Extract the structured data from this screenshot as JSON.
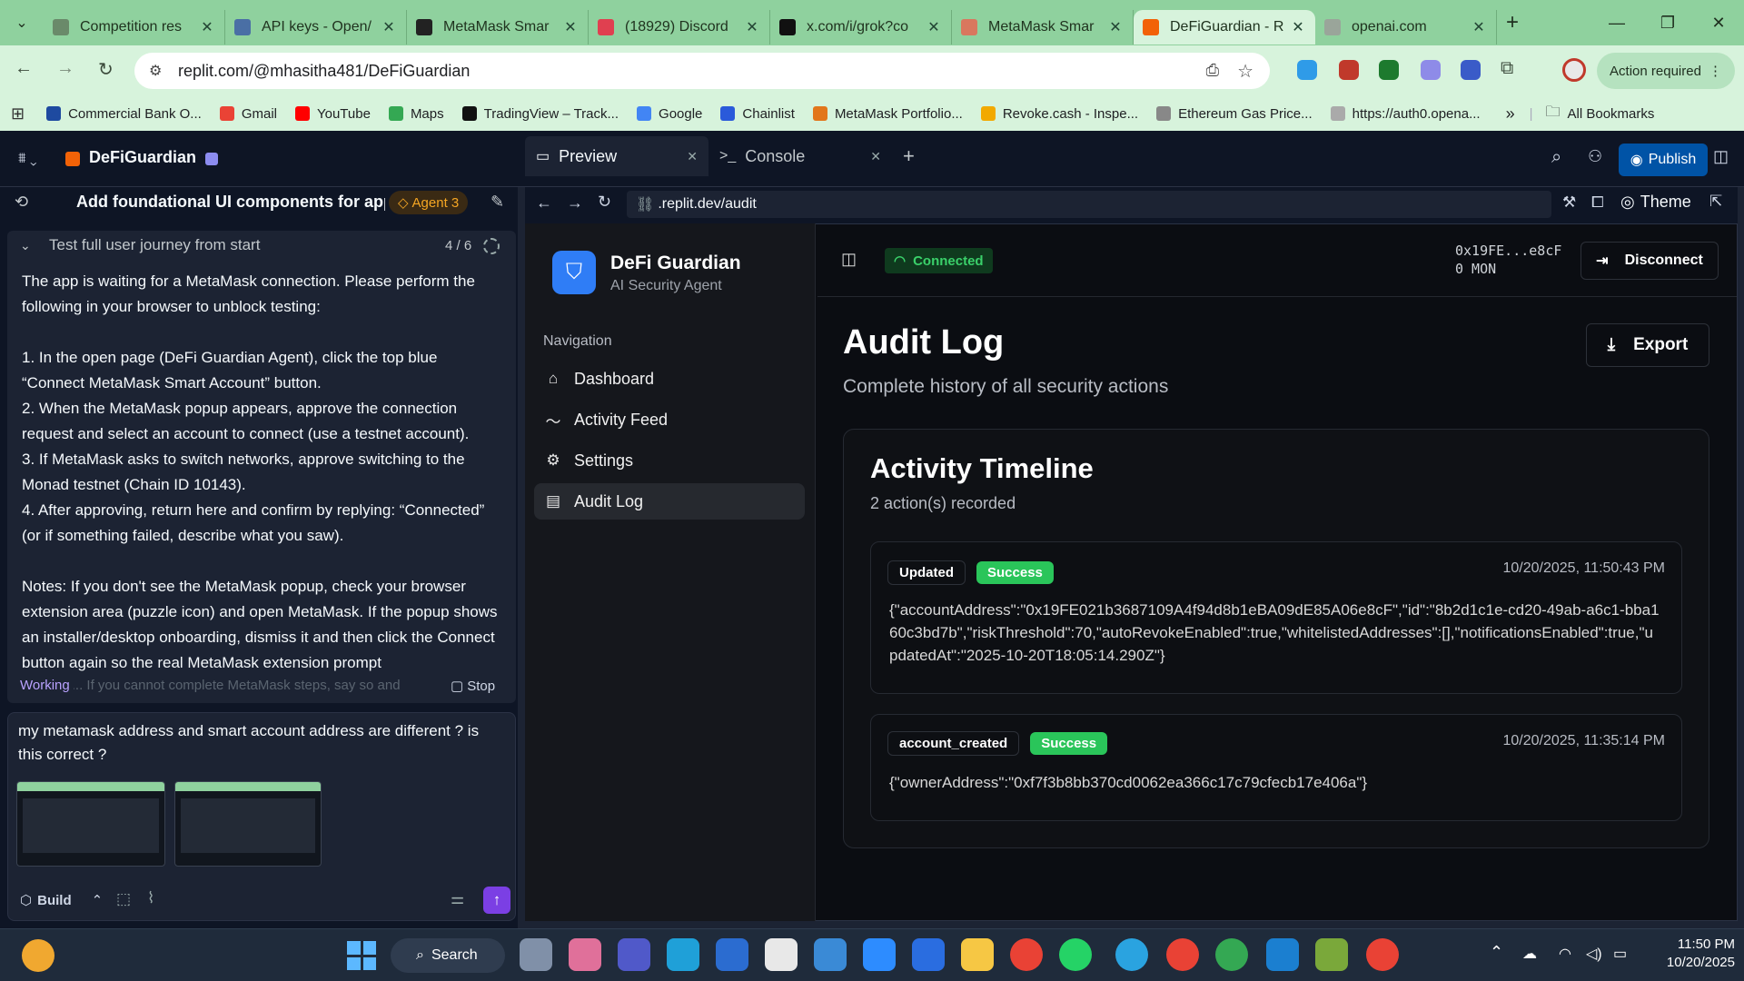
{
  "browser": {
    "tabs": [
      {
        "title": "Competition res",
        "color": "#6a8a6a"
      },
      {
        "title": "API keys - Open/",
        "color": "#4a6fa5"
      },
      {
        "title": "MetaMask Smar",
        "color": "#222222"
      },
      {
        "title": "(18929) Discord",
        "color": "#e04050"
      },
      {
        "title": "x.com/i/grok?co",
        "color": "#111111"
      },
      {
        "title": "MetaMask Smar",
        "color": "#d9775e"
      },
      {
        "title": "DeFiGuardian - R",
        "color": "#f26207"
      },
      {
        "title": "openai.com",
        "color": "#9aa59a"
      }
    ],
    "url": "replit.com/@mhasitha481/DeFiGuardian",
    "action_required": "Action required",
    "bookmarks": [
      {
        "label": "Commercial Bank O...",
        "color": "#1e4aa0"
      },
      {
        "label": "Gmail",
        "color": "#ea4335"
      },
      {
        "label": "YouTube",
        "color": "#ff0000"
      },
      {
        "label": "Maps",
        "color": "#34a853"
      },
      {
        "label": "TradingView – Track...",
        "color": "#111111"
      },
      {
        "label": "Google",
        "color": "#4285f4"
      },
      {
        "label": "Chainlist",
        "color": "#2a5ada"
      },
      {
        "label": "MetaMask Portfolio...",
        "color": "#e2761b"
      },
      {
        "label": "Revoke.cash - Inspe...",
        "color": "#f2a900"
      },
      {
        "label": "Ethereum Gas Price...",
        "color": "#888888"
      },
      {
        "label": "https://auth0.opena...",
        "color": "#aaaaaa"
      }
    ],
    "all_bookmarks": "All Bookmarks"
  },
  "replit": {
    "project": "DeFiGuardian",
    "preview_tab": "Preview",
    "console_tab": "Console",
    "publish": "Publish",
    "task_title": "Add foundational UI components for appl...",
    "agent_badge": "Agent 3",
    "checkpoint_title": "Test full user journey from start",
    "checkpoint_progress": "4 / 6",
    "chat": {
      "p1": "The app is waiting for a MetaMask connection. Please perform the following in your browser to unblock testing:",
      "s1": "1. In the open page (DeFi Guardian Agent), click the top blue “Connect MetaMask Smart Account” button.",
      "s2": "2. When the MetaMask popup appears, approve the connection request and select an account to connect (use a testnet account).",
      "s3": "3. If MetaMask asks to switch networks, approve switching to the Monad testnet (Chain ID 10143).",
      "s4": "4. After approving, return here and confirm by replying: “Connected” (or if something failed, describe what you saw).",
      "notes": "Notes: If you don't see the MetaMask popup, check your browser extension area (puzzle icon) and open MetaMask. If the popup shows an installer/desktop onboarding, dismiss it and then click the Connect button again so the real MetaMask extension prompt",
      "cut": "Working... If you cannot complete MetaMask steps, say so and",
      "working": "Working",
      "stop": "Stop"
    },
    "input_text": "my metamask address and smart account address are different ? is this correct ?",
    "build_label": "Build",
    "preview_url": ".replit.dev/audit",
    "theme": "Theme"
  },
  "app": {
    "name": "DeFi Guardian",
    "tagline": "AI Security Agent",
    "nav_heading": "Navigation",
    "nav": [
      "Dashboard",
      "Activity Feed",
      "Settings",
      "Audit Log"
    ],
    "status": "Connected",
    "address": "0x19FE...e8cF",
    "balance": "0 MON",
    "disconnect": "Disconnect",
    "page_title": "Audit Log",
    "page_subtitle": "Complete history of all security actions",
    "export": "Export",
    "timeline_title": "Activity Timeline",
    "timeline_count": "2 action(s) recorded",
    "entries": [
      {
        "type": "Updated",
        "status": "Success",
        "time": "10/20/2025, 11:50:43 PM",
        "payload": "{\"accountAddress\":\"0x19FE021b3687109A4f94d8b1eBA09dE85A06e8cF\",\"id\":\"8b2d1c1e-cd20-49ab-a6c1-bba160c3bd7b\",\"riskThreshold\":70,\"autoRevokeEnabled\":true,\"whitelistedAddresses\":[],\"notificationsEnabled\":true,\"updatedAt\":\"2025-10-20T18:05:14.290Z\"}"
      },
      {
        "type": "account_created",
        "status": "Success",
        "time": "10/20/2025, 11:35:14 PM",
        "payload": "{\"ownerAddress\":\"0xf7f3b8bb370cd0062ea366c17c79cfecb17e406a\"}"
      }
    ]
  },
  "taskbar": {
    "search": "Search",
    "time": "11:50 PM",
    "date": "10/20/2025"
  }
}
